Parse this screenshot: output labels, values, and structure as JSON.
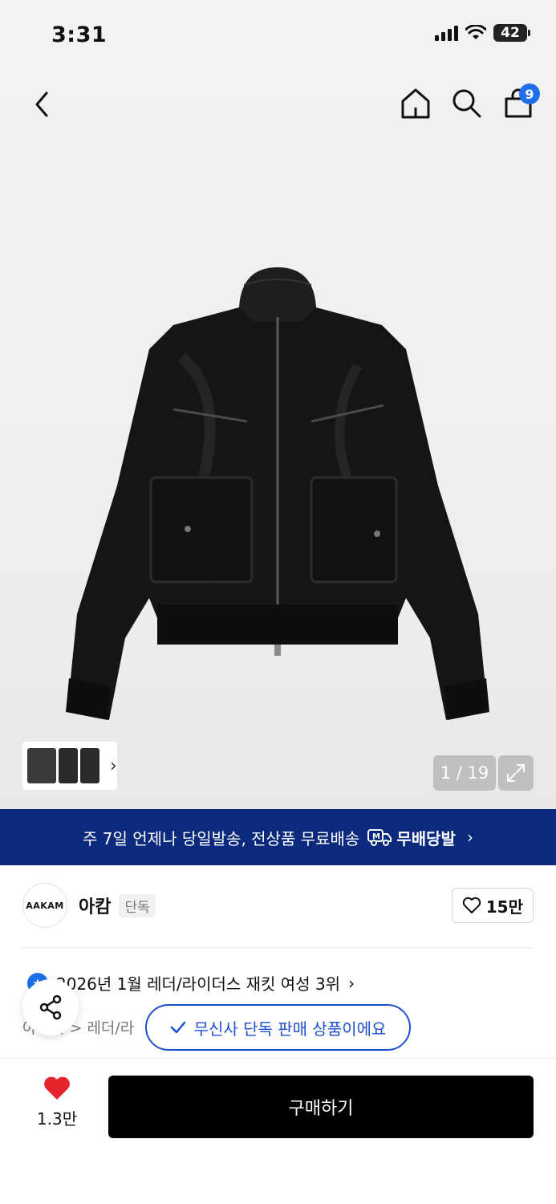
{
  "status_bar": {
    "time": "3:31",
    "battery": "42"
  },
  "nav": {
    "cart_count": "9"
  },
  "gallery": {
    "counter": "1 / 19"
  },
  "banner": {
    "text": "주 7일 언제나 당일발송, 전상품 무료배송",
    "badge_label": "무배당발"
  },
  "brand": {
    "logo_text": "AAKAM",
    "name": "아캄",
    "tag": "단독",
    "likes": "15만"
  },
  "ranking": {
    "text": "2026년 1월 레더/라이더스 재킷 여성 3위"
  },
  "breadcrumb": {
    "text": "아우터 > 레더/라"
  },
  "exclusive_notice": "무신사 단독 판매 상품이에요",
  "bottom": {
    "wish_count": "1.3만",
    "buy_label": "구매하기"
  },
  "colors": {
    "banner_bg": "#0b2a7d",
    "accent_blue": "#1f6feb",
    "wish_red": "#e5242b"
  }
}
